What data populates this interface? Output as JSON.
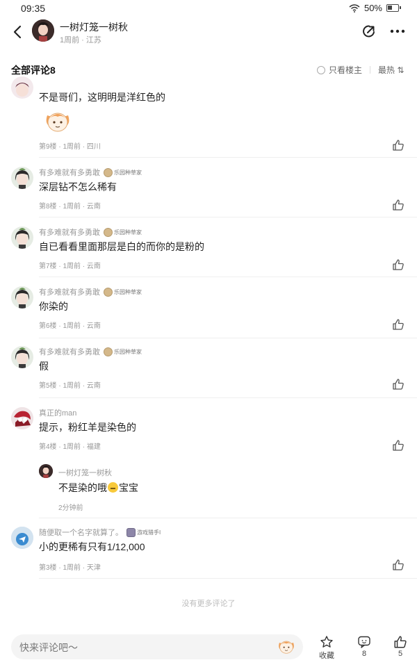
{
  "status_bar": {
    "time": "09:35",
    "battery": "50%"
  },
  "header": {
    "author_name": "一树灯笼一树秋",
    "author_meta": "1周前 · 江苏"
  },
  "comments_header": {
    "title": "全部评论8",
    "filter_label": "只看楼主",
    "sort_label": "最热 ⇅"
  },
  "comments": [
    {
      "text": "不是哥们，这明明是洋红色的",
      "meta": "第9楼 · 1周前 · 四川"
    },
    {
      "user": "有多难就有多勇敢",
      "badge": "乐园种草家",
      "text": "深层钻不怎么稀有",
      "meta": "第8楼 · 1周前 · 云南"
    },
    {
      "user": "有多难就有多勇敢",
      "badge": "乐园种草家",
      "text": "自已看看里面那层是白的而你的是粉的",
      "meta": "第7楼 · 1周前 · 云南"
    },
    {
      "user": "有多难就有多勇敢",
      "badge": "乐园种草家",
      "text": "你染的",
      "meta": "第6楼 · 1周前 · 云南"
    },
    {
      "user": "有多难就有多勇敢",
      "badge": "乐园种草家",
      "text": "假",
      "meta": "第5楼 · 1周前 · 云南"
    },
    {
      "user": "真正的man",
      "text": "提示，粉红羊是染色的",
      "meta": "第4楼 · 1周前 · 福建",
      "reply": {
        "user": "一树灯笼一树秋",
        "text_before": "不是染的哦",
        "text_after": "宝宝",
        "meta": "2分钟前"
      }
    },
    {
      "user": "随便取一个名字就算了。",
      "badge": "游戏猎手I",
      "text": "小的更稀有只有1/12,000",
      "meta": "第3楼 · 1周前 · 天津"
    }
  ],
  "no_more_text": "没有更多评论了",
  "bottom_bar": {
    "input_placeholder": "快来评论吧～",
    "favorite_label": "收藏",
    "comment_count": "8",
    "like_count": "5"
  }
}
